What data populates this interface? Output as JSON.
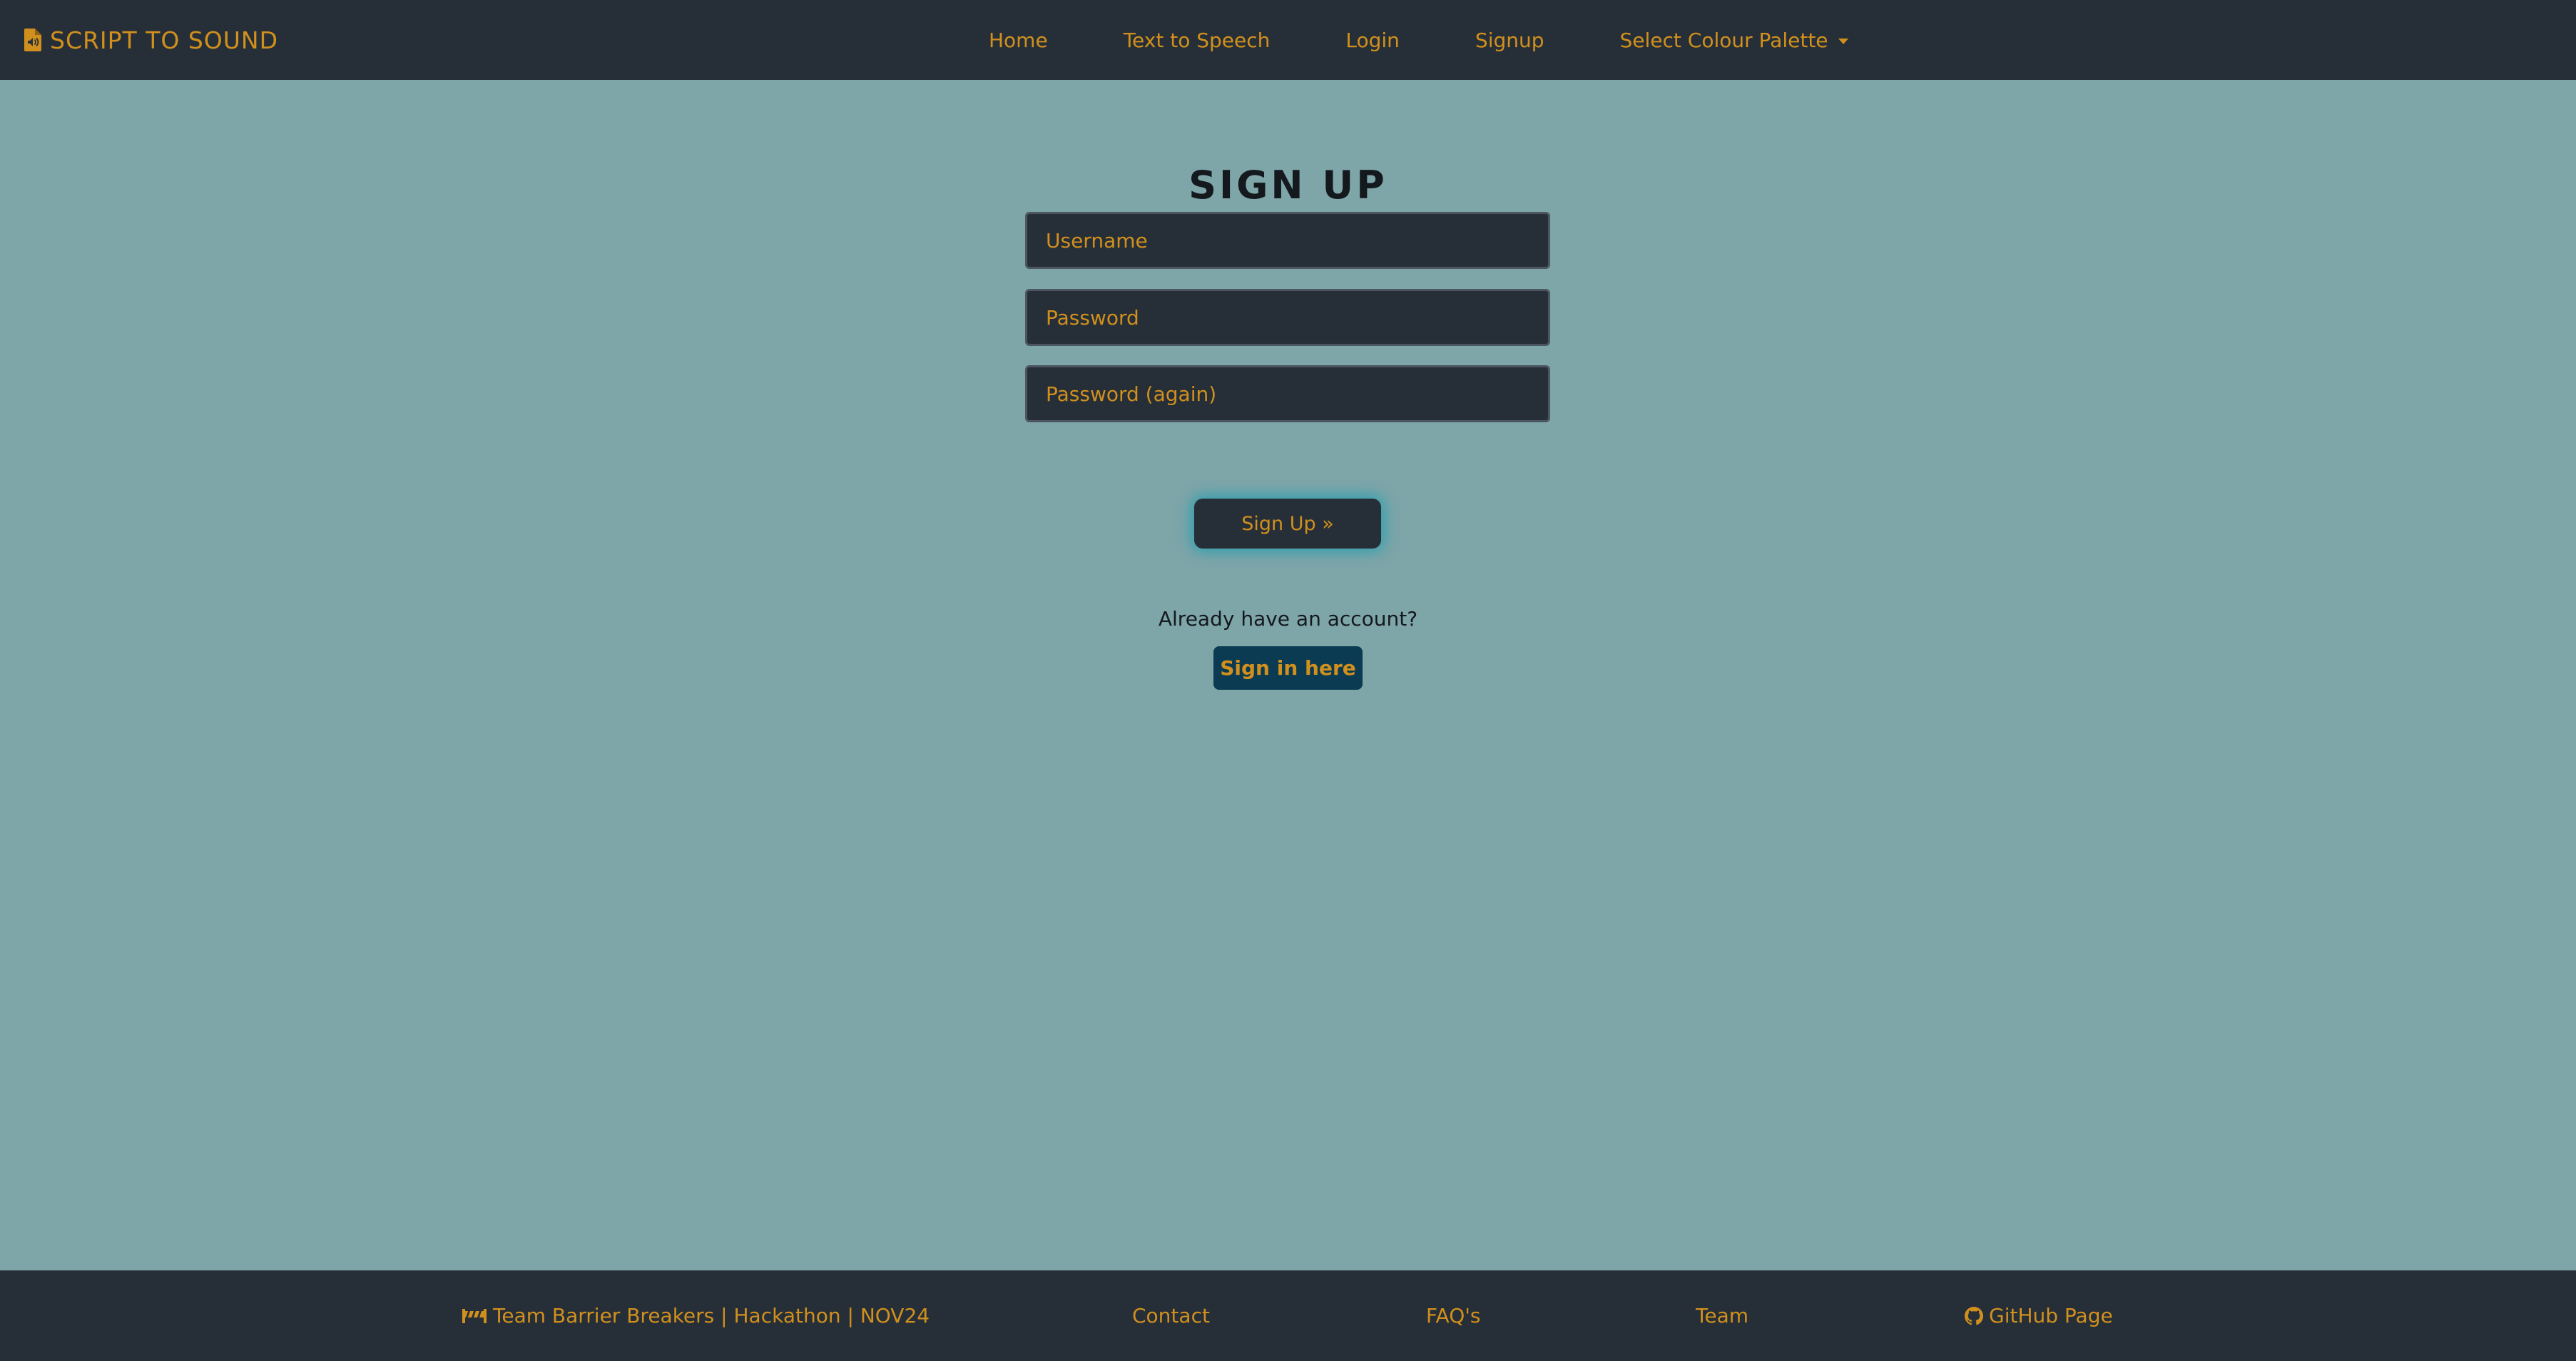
{
  "navbar": {
    "brand_label": "SCRIPT TO SOUND",
    "brand_icon": "file-audio-icon",
    "links": [
      {
        "label": "Home"
      },
      {
        "label": "Text to Speech"
      },
      {
        "label": "Login"
      },
      {
        "label": "Signup"
      },
      {
        "label": "Select Colour Palette"
      }
    ]
  },
  "form": {
    "title": "SIGN UP",
    "username_placeholder": "Username",
    "password_placeholder": "Password",
    "password_again_placeholder": "Password (again)",
    "submit_label": "Sign Up »",
    "already_text": "Already have an account?",
    "signin_label": "Sign in here"
  },
  "footer": {
    "team_label": "Team Barrier Breakers | Hackathon | NOV24",
    "team_icon": "road-barrier-icon",
    "contact_label": "Contact",
    "faq_label": "FAQ's",
    "team_link_label": "Team",
    "github_label": "GitHub Page",
    "github_icon": "github-icon"
  },
  "colors": {
    "background": "#7ea5a8",
    "nav_bg": "#262f38",
    "accent": "#d1901d",
    "signin_bg": "#0b3b52",
    "glow": "#2b9fb0"
  }
}
